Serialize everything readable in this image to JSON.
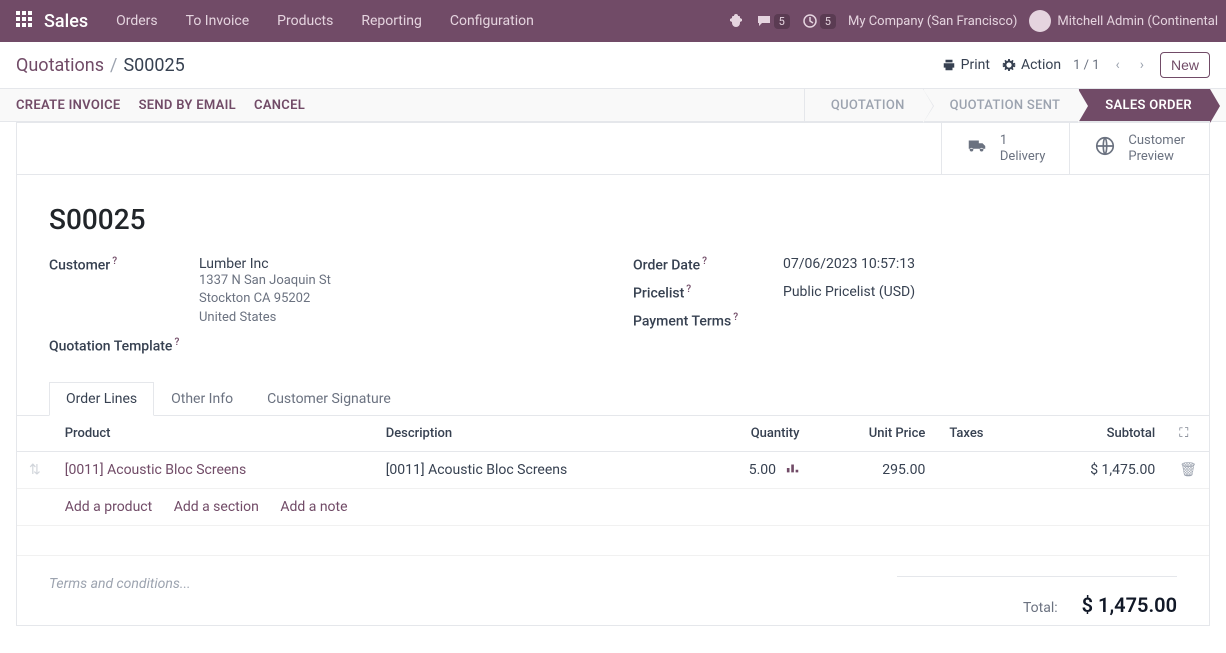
{
  "topbar": {
    "brand": "Sales",
    "nav": [
      "Orders",
      "To Invoice",
      "Products",
      "Reporting",
      "Configuration"
    ],
    "messages_count": "5",
    "activities_count": "5",
    "company": "My Company (San Francisco)",
    "user": "Mitchell Admin (Continental"
  },
  "breadcrumb": {
    "root": "Quotations",
    "current": "S00025"
  },
  "cp": {
    "print": "Print",
    "action": "Action",
    "pager": "1 / 1",
    "new": "New"
  },
  "statusbar": {
    "buttons": [
      "CREATE INVOICE",
      "SEND BY EMAIL",
      "CANCEL"
    ],
    "stages": [
      "QUOTATION",
      "QUOTATION SENT",
      "SALES ORDER"
    ],
    "active_stage": 2
  },
  "button_box": {
    "delivery_count": "1",
    "delivery_label": "Delivery",
    "preview_label_1": "Customer",
    "preview_label_2": "Preview"
  },
  "record": {
    "name": "S00025",
    "labels": {
      "customer": "Customer",
      "quotation_template": "Quotation Template",
      "order_date": "Order Date",
      "pricelist": "Pricelist",
      "payment_terms": "Payment Terms"
    },
    "customer_name": "Lumber Inc",
    "address_line1": "1337 N San Joaquin St",
    "address_line2": "Stockton CA 95202",
    "address_line3": "United States",
    "order_date": "07/06/2023 10:57:13",
    "pricelist": "Public Pricelist (USD)"
  },
  "tabs": [
    "Order Lines",
    "Other Info",
    "Customer Signature"
  ],
  "active_tab": 0,
  "table": {
    "headers": {
      "product": "Product",
      "description": "Description",
      "quantity": "Quantity",
      "unit_price": "Unit Price",
      "taxes": "Taxes",
      "subtotal": "Subtotal"
    },
    "rows": [
      {
        "product": "[0011] Acoustic Bloc Screens",
        "description": "[0011] Acoustic Bloc Screens",
        "quantity": "5.00",
        "unit_price": "295.00",
        "taxes": "",
        "subtotal": "$ 1,475.00"
      }
    ],
    "add_product": "Add a product",
    "add_section": "Add a section",
    "add_note": "Add a note"
  },
  "footer": {
    "terms_placeholder": "Terms and conditions...",
    "total_label": "Total:",
    "total_amount": "$ 1,475.00"
  }
}
